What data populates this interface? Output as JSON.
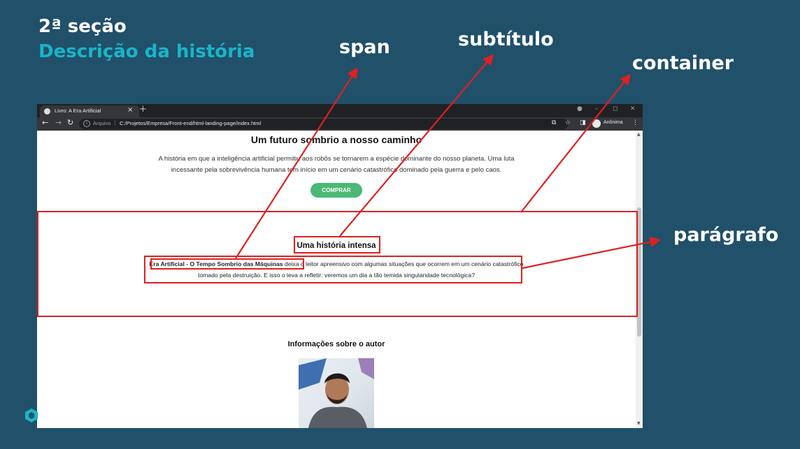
{
  "slide": {
    "title": "2ª seção",
    "subtitle": "Descrição da história"
  },
  "callouts": {
    "span": "span",
    "subtitle": "subtítulo",
    "container": "container",
    "paragraph": "parágrafo"
  },
  "browser": {
    "tab_title": "Livro: A Era Artificial",
    "tab_close": "×",
    "new_tab": "+",
    "url_label": "Arquivo",
    "url_separator": "|",
    "url": "C:/Projetos/Empresa/Front-end/html-landing-page/index.html",
    "profile_label": "Anônima"
  },
  "page": {
    "hero_title": "Um futuro sombrio a nosso caminho",
    "hero_text": "A história em que a inteligência artificial permitiu aos robôs se tornarem a espécie dominante do nosso planeta. Uma luta incessante pela sobrevivência humana tem início em um cenário catastrófico dominado pela guerra e pelo caos.",
    "buy_button": "COMPRAR",
    "story_title": "Uma história intensa",
    "story_span": "Era Artificial - O Tempo Sombrio das Máquinas",
    "story_text": " deixa o leitor apreensivo com algumas situações que ocorrem em um cenário catastrófico tomado pela destruição. E isso o leva a refletir: veremos um dia a tão temida singularidade tecnológica?",
    "author_title": "Informações sobre o autor"
  },
  "colors": {
    "slide_bg": "#21506a",
    "subtitle": "#19b5c8",
    "highlight": "#e02020",
    "buy_button": "#4bb874"
  }
}
